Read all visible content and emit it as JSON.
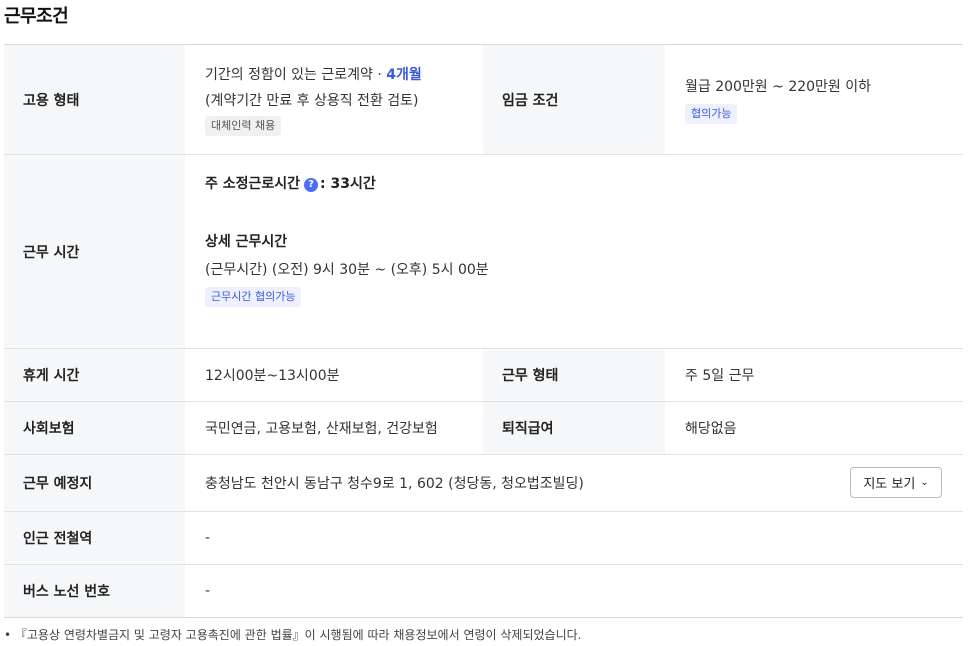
{
  "section_title": "근무조건",
  "employment": {
    "label": "고용 형태",
    "contract": "기간의 정함이 있는 근로계약 · ",
    "duration": "4개월",
    "note": "(계약기간 만료 후 상용직 전환 검토)",
    "tag": "대체인력 채용"
  },
  "wage": {
    "label": "임금 조건",
    "value": "월급 200만원 ~ 220만원 이하",
    "tag": "협의가능"
  },
  "hours": {
    "label": "근무 시간",
    "weekly_label": "주 소정근로시간",
    "help_icon": "?",
    "weekly_value": ": 33시간",
    "detail_label": "상세 근무시간",
    "detail_value": "(근무시간) (오전) 9시 30분 ~ (오후) 5시 00분",
    "tag": "근무시간 협의가능"
  },
  "break": {
    "label": "휴게 시간",
    "value": "12시00분~13시00분"
  },
  "work_type": {
    "label": "근무 형태",
    "value": "주 5일 근무"
  },
  "insurance": {
    "label": "사회보험",
    "value": "국민연금, 고용보험, 산재보험, 건강보험"
  },
  "severance": {
    "label": "퇴직급여",
    "value": "해당없음"
  },
  "location": {
    "label": "근무 예정지",
    "value": "충청남도 천안시 동남구 청수9로 1, 602 (청당동, 청오법조빌딩)",
    "map_button": "지도 보기",
    "chevron": "⌄"
  },
  "subway": {
    "label": "인근 전철역",
    "value": "-"
  },
  "bus": {
    "label": "버스 노선 번호",
    "value": "-"
  },
  "footnote": "• 『고용상 연령차별금지 및 고령자 고용촉진에 관한 법률』이 시행됨에 따라 채용정보에서 연령이 삭제되었습니다."
}
